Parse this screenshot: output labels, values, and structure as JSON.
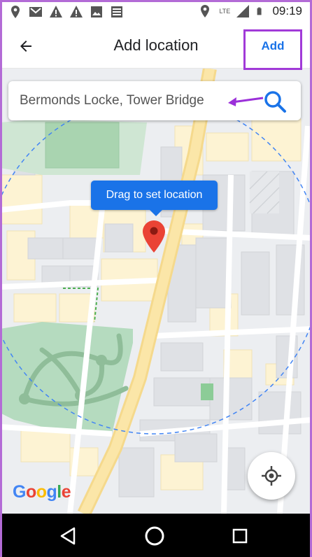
{
  "status_bar": {
    "time": "09:19",
    "network": "LTE",
    "left_icons": [
      "location-icon",
      "gmail-icon",
      "alert-icon",
      "alert-icon",
      "image-icon",
      "news-icon"
    ],
    "right_icons": [
      "location-icon",
      "signal-icon",
      "battery-icon"
    ]
  },
  "app_bar": {
    "title": "Add location",
    "add_label": "Add"
  },
  "search": {
    "value": "Bermonds Locke, Tower Bridge"
  },
  "map": {
    "tooltip": "Drag to set location",
    "google_logo": [
      "G",
      "o",
      "o",
      "g",
      "l",
      "e"
    ],
    "google_colors": [
      "#4285f4",
      "#ea4335",
      "#fbbc05",
      "#4285f4",
      "#34a853",
      "#ea4335"
    ]
  },
  "colors": {
    "accent": "#1a73e8",
    "highlight_border": "#a13ad8",
    "pin": "#ea4335"
  }
}
